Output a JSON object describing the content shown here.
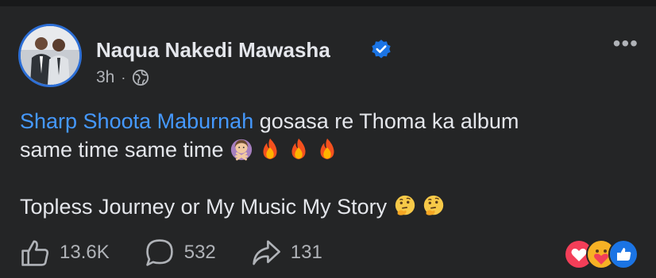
{
  "post": {
    "author": "Naqua Nakedi Mawasha",
    "time": "3h",
    "separator": "·",
    "privacy_icon": "globe-icon",
    "more_icon": "more-options-icon",
    "more_label": "•••",
    "mention": "Sharp Shoota Maburnah",
    "line1_rest": " gosasa re Thoma ka album",
    "line2": "same time same time ",
    "line3": "Topless Journey or My Music My Story ",
    "line2_emojis": [
      "woman-gesturing-no-emoji",
      "fire-emoji",
      "fire-emoji",
      "fire-emoji"
    ],
    "line3_emojis": [
      "thinking-face-emoji",
      "thinking-face-emoji"
    ]
  },
  "actions": {
    "like_count": "13.6K",
    "comment_count": "532",
    "share_count": "131"
  },
  "reactions": [
    "love-reaction",
    "care-reaction",
    "like-reaction"
  ],
  "colors": {
    "background": "#242526",
    "text": "#e4e6eb",
    "secondary": "#b0b3b8",
    "mention": "#4599ff",
    "verified": "#1b74e4"
  }
}
